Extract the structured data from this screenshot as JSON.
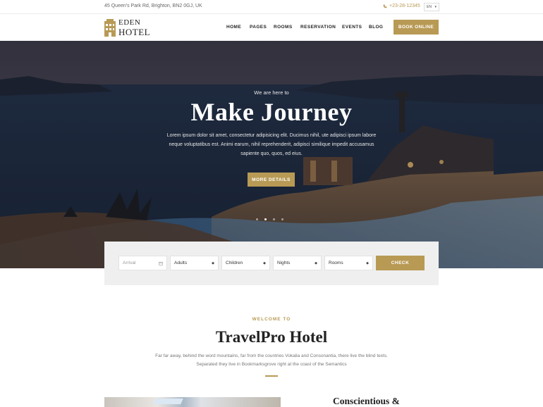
{
  "topbar": {
    "address": "45 Queen's Park Rd, Brighton, BN2 0GJ, UK",
    "phone": "+23-28-12345",
    "language": "EN"
  },
  "header": {
    "logo_line1": "EDEN",
    "logo_line2": "HOTEL",
    "nav": [
      "HOME",
      "PAGES",
      "ROOMS",
      "RESERVATION",
      "EVENTS",
      "BLOG"
    ],
    "book_label": "BOOK ONLINE"
  },
  "hero": {
    "subtitle": "We are here to",
    "title": "Make Journey",
    "description": "Lorem ipsum dolor sit amet, consectetur adipisicing elit. Ducimus nihil, ute adipisci ipsum labore neque voluptatibus est. Animi earum, nihil reprehenderit, adipisci similique impedit accusamus sapiente quo, quos, ed eius.",
    "button_label": "MORE DETAILS",
    "slide_count": 4,
    "active_slide": 1
  },
  "booking": {
    "arrival_placeholder": "Arrival",
    "adults": "Adults",
    "children": "Children",
    "nights": "Nights",
    "rooms": "Rooms",
    "check_label": "CHECK"
  },
  "welcome": {
    "eyebrow": "WELCOME TO",
    "title": "TravelPro Hotel",
    "description": "Far far away, behind the word mountains, far from the countries Vokalia and Consonantia, there live the blind texts. Separated they live in Bookmarksgrove right at the coast of the Semantics"
  },
  "feature": {
    "title": "Conscientious &"
  },
  "colors": {
    "accent": "#b89a55",
    "text_dark": "#222222",
    "form_bg": "#efefef"
  }
}
